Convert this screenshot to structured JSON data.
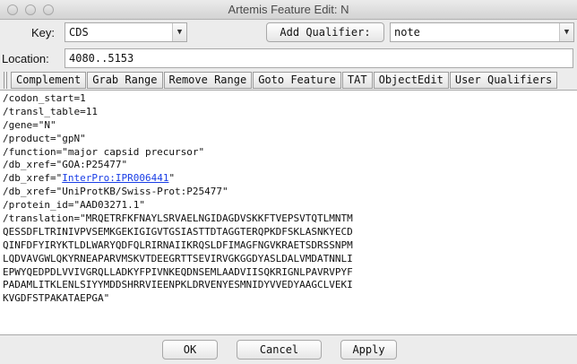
{
  "window": {
    "title": "Artemis Feature Edit: N"
  },
  "key": {
    "label": "Key:",
    "value": "CDS"
  },
  "add_qualifier": {
    "label": "Add Qualifier:",
    "value": "note"
  },
  "location": {
    "label": "Location:",
    "value": "4080..5153"
  },
  "toolbar": {
    "items": [
      "Complement",
      "Grab Range",
      "Remove Range",
      "Goto Feature",
      "TAT",
      "ObjectEdit",
      "User Qualifiers"
    ]
  },
  "qualifiers": {
    "lines": [
      "/codon_start=1",
      "/transl_table=11",
      "/gene=\"N\"",
      "/product=\"gpN\"",
      "/function=\"major capsid precursor\"",
      "/db_xref=\"GOA:P25477\""
    ],
    "interpro_prefix": "/db_xref=\"",
    "interpro_link": "InterPro:IPR006441",
    "interpro_suffix": "\"",
    "lines_after": [
      "/db_xref=\"UniProtKB/Swiss-Prot:P25477\"",
      "/protein_id=\"AAD03271.1\"",
      "/translation=\"MRQETRFKFNAYLSRVAELNGIDAGDVSKKFTVEPSVTQTLMNTM",
      "QESSDFLTRINIVPVSEMKGEKIGIGVTGSIASTTDTAGGTERQPKDFSKLASNKYECD",
      "QINFDFYIRYKTLDLWARYQDFQLRIRNAIIKRQSLDFIMAGFNGVKRAETSDRSSNPM",
      "LQDVAVGWLQKYRNEAPARVMSKVTDEEGRTTSEVIRVGKGGDYASLDALVMDATNNLI",
      "EPWYQEDPDLVVIVGRQLLADKYFPIVNKEQDNSEMLAADVIISQKRIGNLPAVRVPYF",
      "PADAMLITKLENLSIYYMDDSHRRVIEENPKLDRVENYESMNIDYVVEDYAAGCLVEKI",
      "KVGDFSTPAKATAEPGA\""
    ]
  },
  "buttons": {
    "ok": "OK",
    "cancel": "Cancel",
    "apply": "Apply"
  },
  "colors": {
    "link": "#1a3ee6"
  }
}
